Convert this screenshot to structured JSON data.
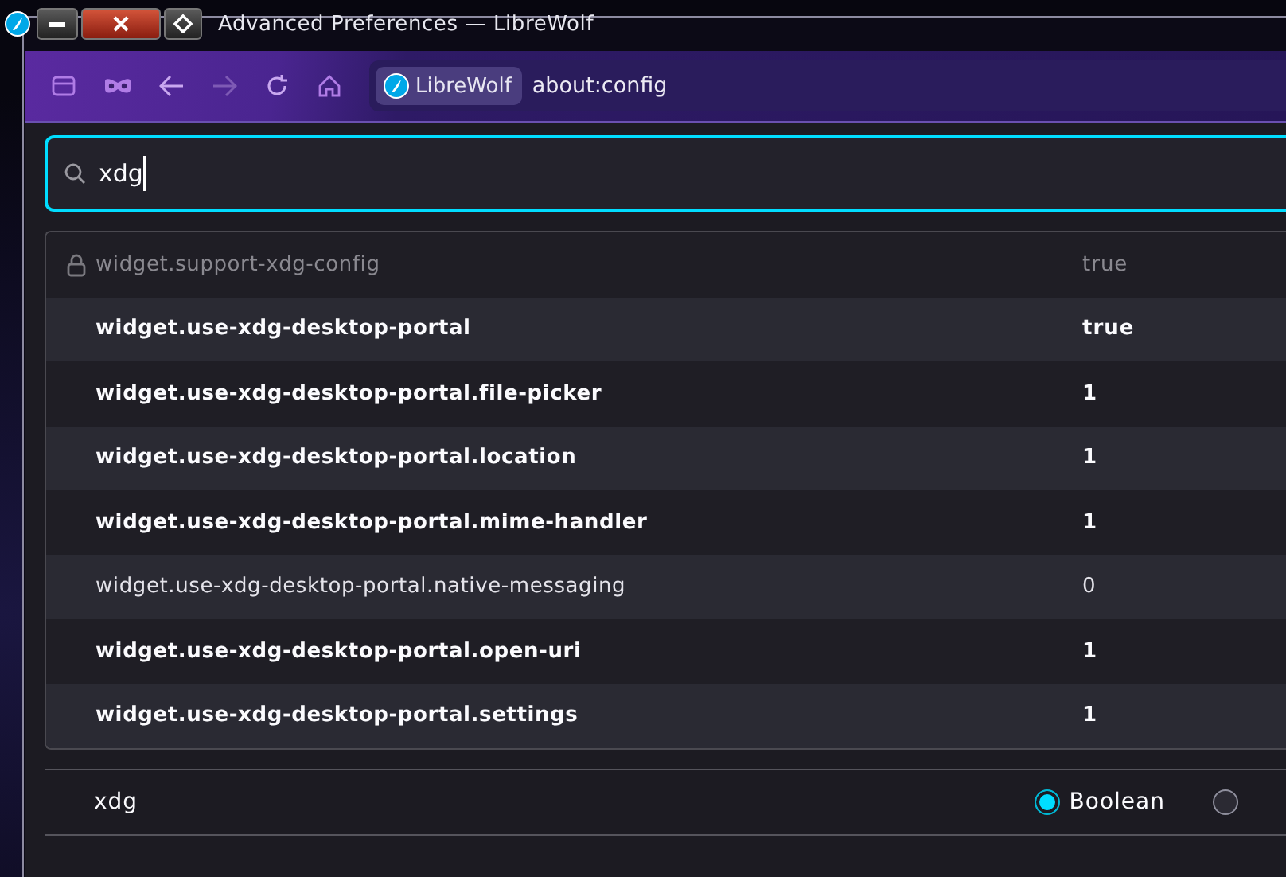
{
  "window": {
    "title": "Advanced Preferences — LibreWolf"
  },
  "toolbar": {
    "identity_label": "LibreWolf",
    "url": "about:config"
  },
  "search": {
    "value": "xdg"
  },
  "prefs": [
    {
      "name": "widget.support-xdg-config",
      "value": "true",
      "locked": true,
      "modified": false
    },
    {
      "name": "widget.use-xdg-desktop-portal",
      "value": "true",
      "locked": false,
      "modified": true
    },
    {
      "name": "widget.use-xdg-desktop-portal.file-picker",
      "value": "1",
      "locked": false,
      "modified": true
    },
    {
      "name": "widget.use-xdg-desktop-portal.location",
      "value": "1",
      "locked": false,
      "modified": true
    },
    {
      "name": "widget.use-xdg-desktop-portal.mime-handler",
      "value": "1",
      "locked": false,
      "modified": true
    },
    {
      "name": "widget.use-xdg-desktop-portal.native-messaging",
      "value": "0",
      "locked": false,
      "modified": false
    },
    {
      "name": "widget.use-xdg-desktop-portal.open-uri",
      "value": "1",
      "locked": false,
      "modified": true
    },
    {
      "name": "widget.use-xdg-desktop-portal.settings",
      "value": "1",
      "locked": false,
      "modified": true
    }
  ],
  "new_pref": {
    "name": "xdg",
    "types": [
      {
        "label": "Boolean",
        "selected": true
      },
      {
        "selected": false
      }
    ]
  }
}
